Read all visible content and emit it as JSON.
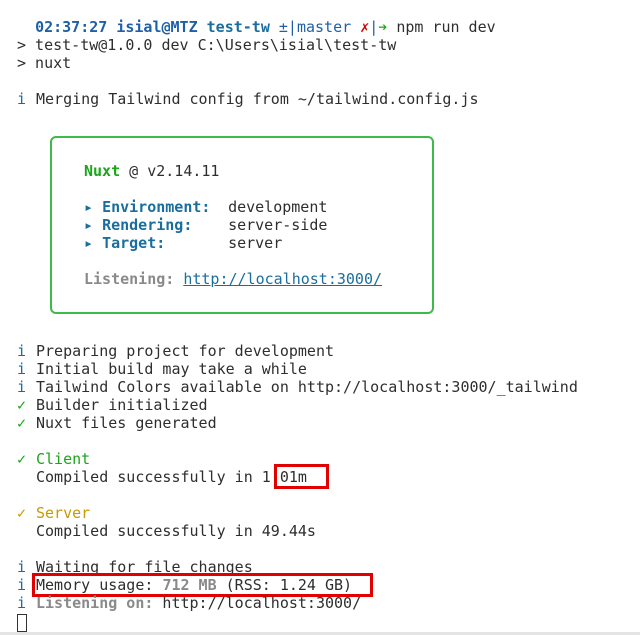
{
  "prompt": {
    "time": "02:37:27",
    "user_host": "isial@MTZ",
    "dir": "test-tw",
    "git_prefix": "±|",
    "branch": "master",
    "dirty": "✗",
    "git_suffix": "|",
    "arrow": "➔",
    "command": "npm run dev"
  },
  "npm_lines": [
    "> test-tw@1.0.0 dev C:\\Users\\isial\\test-tw",
    "> nuxt"
  ],
  "info_icon": "i",
  "check_icon": "✓",
  "tailwind_merge": "Merging Tailwind config from ~/tailwind.config.js",
  "banner": {
    "name": "Nuxt",
    "at": "@ v2.14.11",
    "bullet": "▸",
    "env_label": "Environment:",
    "env_value": "development",
    "render_label": "Rendering:",
    "render_value": "server-side",
    "target_label": "Target:",
    "target_value": "server",
    "listen_label": "Listening:",
    "listen_url": "http://localhost:3000/"
  },
  "progress": [
    {
      "icon": "i",
      "text": "Preparing project for development"
    },
    {
      "icon": "i",
      "text": "Initial build may take a while"
    },
    {
      "icon": "i",
      "text": "Tailwind Colors available on http://localhost:3000/_tailwind"
    },
    {
      "icon": "✓",
      "text": "Builder initialized"
    },
    {
      "icon": "✓",
      "text": "Nuxt files generated"
    }
  ],
  "client": {
    "label": "Client",
    "compiled_prefix": "Compiled successfully in ",
    "time": "1.01m"
  },
  "server": {
    "label": "Server",
    "compiled_text": "Compiled successfully in 49.44s"
  },
  "final": {
    "waiting": "Waiting for file changes",
    "memory_prefix": "Memory usage: ",
    "memory_value": "712 MB",
    "memory_rss": " (RSS: 1.24 GB)",
    "listening_label": "Listening on:",
    "listening_url": " http://localhost:3000/"
  },
  "colors": {
    "highlight": "#e00000",
    "nuxt_green": "#1aa51a",
    "box_border": "#3fb94a",
    "server_gold": "#c79a00"
  }
}
